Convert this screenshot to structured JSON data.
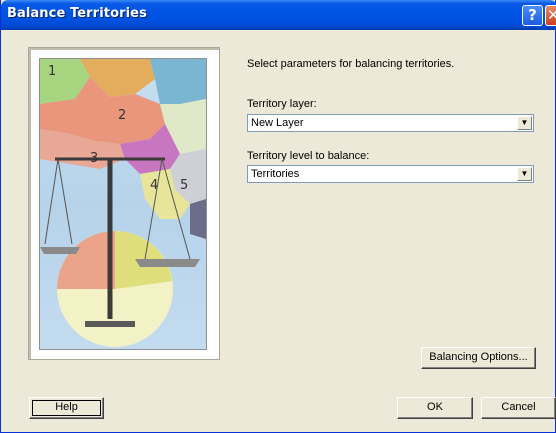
{
  "window": {
    "title": "Balance Territories"
  },
  "titlebar": {
    "help_glyph": "?",
    "close_glyph": "✕"
  },
  "art": {
    "numbers": [
      "1",
      "2",
      "3",
      "4",
      "5"
    ]
  },
  "form": {
    "prompt": "Select parameters for balancing territories.",
    "territory_layer_label": "Territory layer:",
    "territory_layer_value": "New Layer",
    "territory_level_label": "Territory level to balance:",
    "territory_level_value": "Territories"
  },
  "buttons": {
    "balancing_options": "Balancing Options...",
    "help": "Help",
    "ok": "OK",
    "cancel": "Cancel"
  }
}
